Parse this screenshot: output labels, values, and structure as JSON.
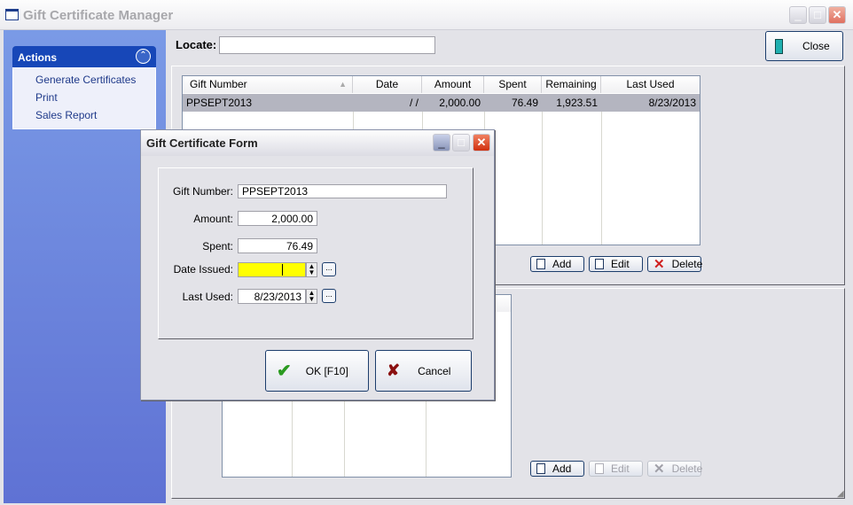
{
  "window": {
    "title": "Gift Certificate Manager"
  },
  "actions": {
    "header": "Actions",
    "items": [
      "Generate Certificates",
      "Print",
      "Sales Report"
    ]
  },
  "locate": {
    "label": "Locate:",
    "value": ""
  },
  "close_button": "Close",
  "grid": {
    "columns": [
      "Gift Number",
      "Date",
      "Amount",
      "Spent",
      "Remaining",
      "Last Used"
    ],
    "rows": [
      {
        "gift_number": "PPSEPT2013",
        "date": "/ /",
        "amount": "2,000.00",
        "spent": "76.49",
        "remaining": "1,923.51",
        "last_used": "8/23/2013"
      }
    ]
  },
  "upper_buttons": {
    "add": "Add",
    "edit": "Edit",
    "delete": "Delete"
  },
  "lower_buttons": {
    "add": "Add",
    "edit": "Edit",
    "delete": "Delete"
  },
  "dialog": {
    "title": "Gift Certificate Form",
    "gift_number_label": "Gift Number:",
    "gift_number": "PPSEPT2013",
    "amount_label": "Amount:",
    "amount": "2,000.00",
    "spent_label": "Spent:",
    "spent": "76.49",
    "date_issued_label": "Date Issued:",
    "date_issued": "",
    "last_used_label": "Last Used:",
    "last_used": "8/23/2013",
    "ellipsis": "...",
    "ok": "OK [F10]",
    "cancel": "Cancel"
  },
  "colors": {
    "date_issued_highlight": "#ffff00",
    "actions_header": "#1747b8",
    "selected_row": "#b4b5c0"
  }
}
